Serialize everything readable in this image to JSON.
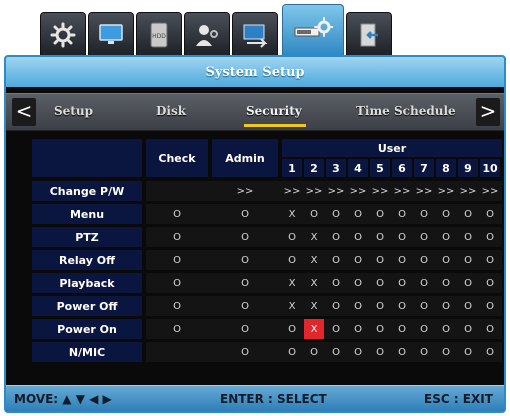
{
  "tabs": [
    {
      "icon": "gear-icon",
      "active": false
    },
    {
      "icon": "monitor-icon",
      "active": false
    },
    {
      "icon": "hdd-icon",
      "active": false
    },
    {
      "icon": "user-settings-icon",
      "active": false
    },
    {
      "icon": "network-icon",
      "active": false
    },
    {
      "icon": "system-setup-icon",
      "active": true
    },
    {
      "icon": "exit-door-icon",
      "active": false
    }
  ],
  "title": "System Setup",
  "nav": {
    "prev_arrow": "<",
    "next_arrow": ">",
    "items": [
      "Setup",
      "Disk",
      "Security",
      "Time Schedule"
    ],
    "active": "Security"
  },
  "table": {
    "col_check": "Check",
    "col_admin": "Admin",
    "col_user": "User",
    "user_numbers": [
      "1",
      "2",
      "3",
      "4",
      "5",
      "6",
      "7",
      "8",
      "9",
      "10"
    ],
    "rows": [
      {
        "label": "Change P/W",
        "check": "",
        "admin": ">>",
        "users": [
          ">>",
          ">>",
          ">>",
          ">>",
          ">>",
          ">>",
          ">>",
          ">>",
          ">>",
          ">>"
        ]
      },
      {
        "label": "Menu",
        "check": "O",
        "admin": "O",
        "users": [
          "X",
          "O",
          "O",
          "O",
          "O",
          "O",
          "O",
          "O",
          "O",
          "O"
        ]
      },
      {
        "label": "PTZ",
        "check": "O",
        "admin": "O",
        "users": [
          "O",
          "X",
          "O",
          "O",
          "O",
          "O",
          "O",
          "O",
          "O",
          "O"
        ]
      },
      {
        "label": "Relay Off",
        "check": "O",
        "admin": "O",
        "users": [
          "O",
          "X",
          "O",
          "O",
          "O",
          "O",
          "O",
          "O",
          "O",
          "O"
        ]
      },
      {
        "label": "Playback",
        "check": "O",
        "admin": "O",
        "users": [
          "X",
          "X",
          "O",
          "O",
          "O",
          "O",
          "O",
          "O",
          "O",
          "O"
        ]
      },
      {
        "label": "Power Off",
        "check": "O",
        "admin": "O",
        "users": [
          "X",
          "X",
          "O",
          "O",
          "O",
          "O",
          "O",
          "O",
          "O",
          "O"
        ]
      },
      {
        "label": "Power On",
        "check": "O",
        "admin": "O",
        "users": [
          "O",
          "X",
          "O",
          "O",
          "O",
          "O",
          "O",
          "O",
          "O",
          "O"
        ]
      },
      {
        "label": "N/MIC",
        "check": "",
        "admin": "O",
        "users": [
          "O",
          "O",
          "O",
          "O",
          "O",
          "O",
          "O",
          "O",
          "O",
          "O"
        ]
      }
    ],
    "selected_cell": {
      "row": 6,
      "user": 2
    }
  },
  "footer": {
    "move": "MOVE: ▲ ▼ ◀ ▶",
    "enter": "ENTER : SELECT",
    "esc": "ESC : EXIT"
  },
  "colors": {
    "accent": "#2c8cc7",
    "header_navy": "#0b1640",
    "selection_red": "#e3262c",
    "tab_underline": "#f3c81b"
  }
}
